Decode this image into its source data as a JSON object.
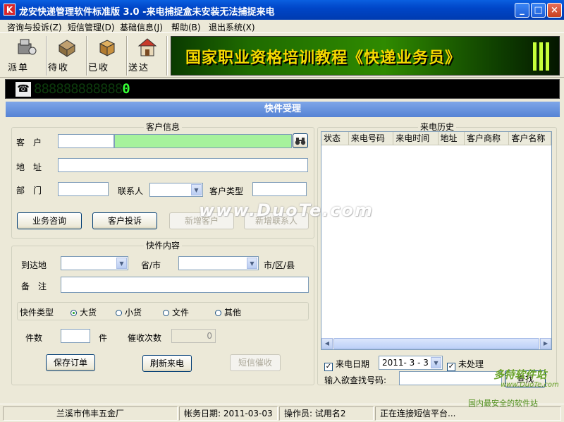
{
  "window": {
    "icon_letter": "K",
    "title": "龙安快递管理软件标准版 3.0 -来电捕捉盒未安装无法捕捉来电",
    "minimize": "_",
    "maximize": "□",
    "close": "×"
  },
  "menu": [
    "咨询与投诉(Z)",
    "短信管理(D)",
    "基础信息(J)",
    "帮助(B)",
    "退出系统(X)"
  ],
  "toolbar": {
    "buttons": [
      {
        "label": "派单",
        "icon": "dispatch-icon"
      },
      {
        "label": "待收",
        "icon": "pending-receive-icon"
      },
      {
        "label": "已收",
        "icon": "received-icon"
      },
      {
        "label": "送达",
        "icon": "delivered-icon"
      }
    ],
    "banner_text": "国家职业资格培训教程《快递业务员》"
  },
  "caller_display": {
    "icon": "phone-icon",
    "digits_dim": "888888888888",
    "digit_lit": "0"
  },
  "panel_title": "快件受理",
  "customer_info": {
    "title": "客户信息",
    "customer_label": "客　户",
    "address_label": "地　址",
    "department_label": "部　门",
    "contact_label": "联系人",
    "customer_type_label": "客户类型",
    "search_icon": "binoculars-icon",
    "buttons": {
      "consult": "业务咨询",
      "complaint": "客户投诉",
      "new_customer": "新增客户",
      "new_contact": "新增联系人"
    }
  },
  "package": {
    "title": "快件内容",
    "destination_label": "到达地",
    "province_label": "省/市",
    "district_label": "市/区/县",
    "remarks_label": "备　注",
    "type_label": "快件类型",
    "types": [
      "大货",
      "小货",
      "文件",
      "其他"
    ],
    "selected_type": "大货",
    "count_label": "件数",
    "count_unit": "件",
    "remind_label": "催收次数",
    "remind_value": "0",
    "buttons": {
      "save": "保存订单",
      "refresh": "刷新来电",
      "sms": "短信催收"
    }
  },
  "history": {
    "title": "来电历史",
    "columns": [
      "状态",
      "来电号码",
      "来电时间",
      "地址",
      "客户商称",
      "客户名称"
    ],
    "date_checkbox": "来电日期",
    "date_checked": true,
    "date_value": "2011- 3 - 3",
    "unprocessed_checkbox": "未处理",
    "unprocessed_checked": true,
    "search_label": "输入欲查找号码:",
    "search_button": "查找"
  },
  "statusbar": {
    "company": "兰溪市伟丰五金厂",
    "account_date": "帐务日期: 2011-03-03",
    "operator": "操作员: 试用名2",
    "connection": "正在连接短信平台..."
  },
  "watermarks": {
    "center": "www.DuoTe.com",
    "corner_top": "多特软件站",
    "corner_url": "www.DuoTe.com",
    "corner_bottom": "国内最安全的软件站"
  }
}
